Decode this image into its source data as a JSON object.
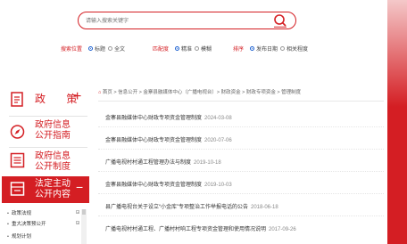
{
  "search": {
    "placeholder": "请输入搜索关键字"
  },
  "filters": {
    "position": {
      "label": "搜索位置",
      "options": [
        "标题",
        "全文"
      ],
      "selected": "标题"
    },
    "match": {
      "label": "匹配度",
      "options": [
        "精准",
        "模糊"
      ],
      "selected": "精准"
    },
    "sort": {
      "label": "排序",
      "options": [
        "发布日期",
        "相关程度"
      ],
      "selected": "发布日期"
    }
  },
  "sidebar": {
    "items": [
      {
        "label": "政 策"
      },
      {
        "label": "政府信息\n公开指南"
      },
      {
        "label": "政府信息\n公开制度"
      },
      {
        "label": "法定主动\n公开内容"
      }
    ],
    "sub_items": [
      "政策法规",
      "重大决策预公开",
      "规划计划"
    ]
  },
  "breadcrumb": "首页 > 信息公开 > 金寨县融媒体中心（广播电视台）> 财政资金 > 财政专项资金 > 管理制度",
  "news": [
    {
      "title": "金寨县融媒体中心财政专项资金管理制度",
      "date": "2024-03-08"
    },
    {
      "title": "金寨县融媒体中心财政专项资金管理制度",
      "date": "2020-07-06"
    },
    {
      "title": "广播电视村村通工程管理办法与制度",
      "date": "2019-10-18"
    },
    {
      "title": "金寨县融媒体中心财政专项资金管理制度",
      "date": "2019-10-03"
    },
    {
      "title": "县广播电视台关于设立“小金库”专项整治工作举报电话的公告",
      "date": "2018-06-18"
    },
    {
      "title": "广播电视村村通工程、广播村村响工程专项资金管理和使用情况说明",
      "date": "2017-09-26"
    }
  ],
  "colors": {
    "accent": "#d41e23",
    "radio": "#1a5fd0"
  }
}
